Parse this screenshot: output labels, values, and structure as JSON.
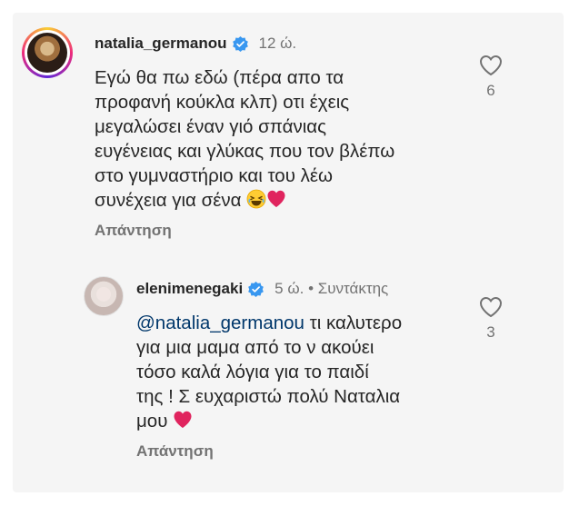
{
  "comments": [
    {
      "username": "natalia_germanou",
      "time": "12 ώ.",
      "lines": [
        "Εγώ θα πω εδώ (πέρα απο τα",
        "προφανή κούκλα κλπ) οτι έχεις",
        "μεγαλώσει έναν γιό σπάνιας",
        "ευγένειας και γλύκας που τον βλέπω",
        "στο γυμναστήριο και του λέω",
        "συνέχεια για σένα"
      ],
      "reply_label": "Απάντηση",
      "likes": "6"
    },
    {
      "username": "elenimenegaki",
      "time": "5 ώ. • Συντάκτης",
      "mention": "@natalia_germanou",
      "lines": [
        " τι καλυτερο",
        "για μια μαμα από το ν ακούει",
        "τόσο καλά λόγια για το παιδί",
        "της ! Σ ευχαριστώ πολύ Ναταλια",
        "μου"
      ],
      "reply_label": "Απάντηση",
      "likes": "3"
    }
  ],
  "colors": {
    "verified": "#3897f0",
    "heart_emoji": "#e0245e",
    "secondary_text": "#737373",
    "mention": "#00376b"
  },
  "icons": [
    "verified-badge-icon",
    "heart-outline-icon",
    "laughing-emoji-icon",
    "red-heart-emoji-icon"
  ]
}
